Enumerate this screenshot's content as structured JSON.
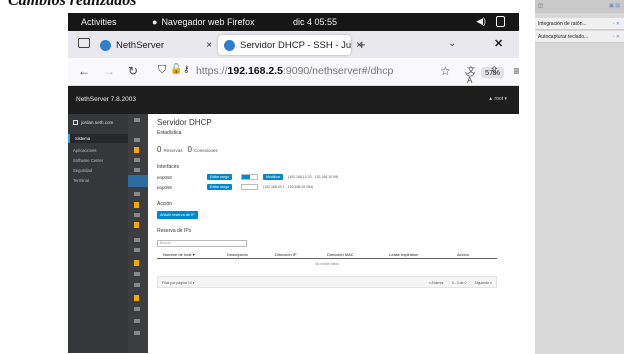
{
  "heading": "Cambios realizados",
  "gnome": {
    "activities": "Activities",
    "app_name": "Navegador web Firefox",
    "clock": "dic 4  05:55"
  },
  "tabs": [
    {
      "label": "NethServer",
      "close": "×"
    },
    {
      "label": "Servidor DHCP - SSH - Ju",
      "close": "×"
    }
  ],
  "browser": {
    "new_tab": "+",
    "url_prefix": "https://",
    "url_host": "192.168.2.5",
    "url_rest": ":9090/nethserver#/dhcp",
    "zoom": "57%"
  },
  "nethserver": {
    "brand": "NethServer 7.8.2003",
    "user": "▲  root ▾"
  },
  "sidebar": {
    "host": "jordan.neth.com",
    "items": [
      {
        "label": "Sistema"
      },
      {
        "label": "Aplicaciones"
      },
      {
        "label": "Software Center"
      },
      {
        "label": "Seguridad"
      },
      {
        "label": "Terminal"
      }
    ]
  },
  "page": {
    "title": "Servidor DHCP",
    "stats_heading": "Estadística",
    "reservas_count": "0",
    "reservas_label": "Reservas",
    "conexiones_count": "0",
    "conexiones_label": "Conexiones",
    "interfaces_heading": "Interfaces",
    "interfaces": [
      {
        "name": "enp0s8",
        "edit_label": "Editar rango",
        "enabled": true,
        "modify_label": "Modificar",
        "range": "(192.168.10.20 - 192.168.10.99)"
      },
      {
        "name": "enp0s9",
        "edit_label": "Editar rango",
        "enabled": false,
        "range": "(192.168.20.1 - 192.168.20.254)"
      }
    ],
    "actions_heading": "Acción",
    "reserve_button": "Añadir reserva de IP",
    "reservations_heading": "Reserva de IPs",
    "search_placeholder": "Buscar",
    "table_columns": [
      "Nombre de host ▾",
      "Descripción",
      "Dirección IP",
      "Dirección MAC",
      "Lease expiration",
      "Acción"
    ],
    "table_empty": "No existe datos",
    "pager_left": "Filas por página  10 ▾",
    "pager_prev": "« Anterior",
    "pager_info": "0 - 0 de 0",
    "pager_next": "Siguiente »"
  },
  "right_panel": {
    "items": [
      {
        "label": "Integración de ratón..."
      },
      {
        "label": "Autocapturar teclado..."
      }
    ]
  }
}
